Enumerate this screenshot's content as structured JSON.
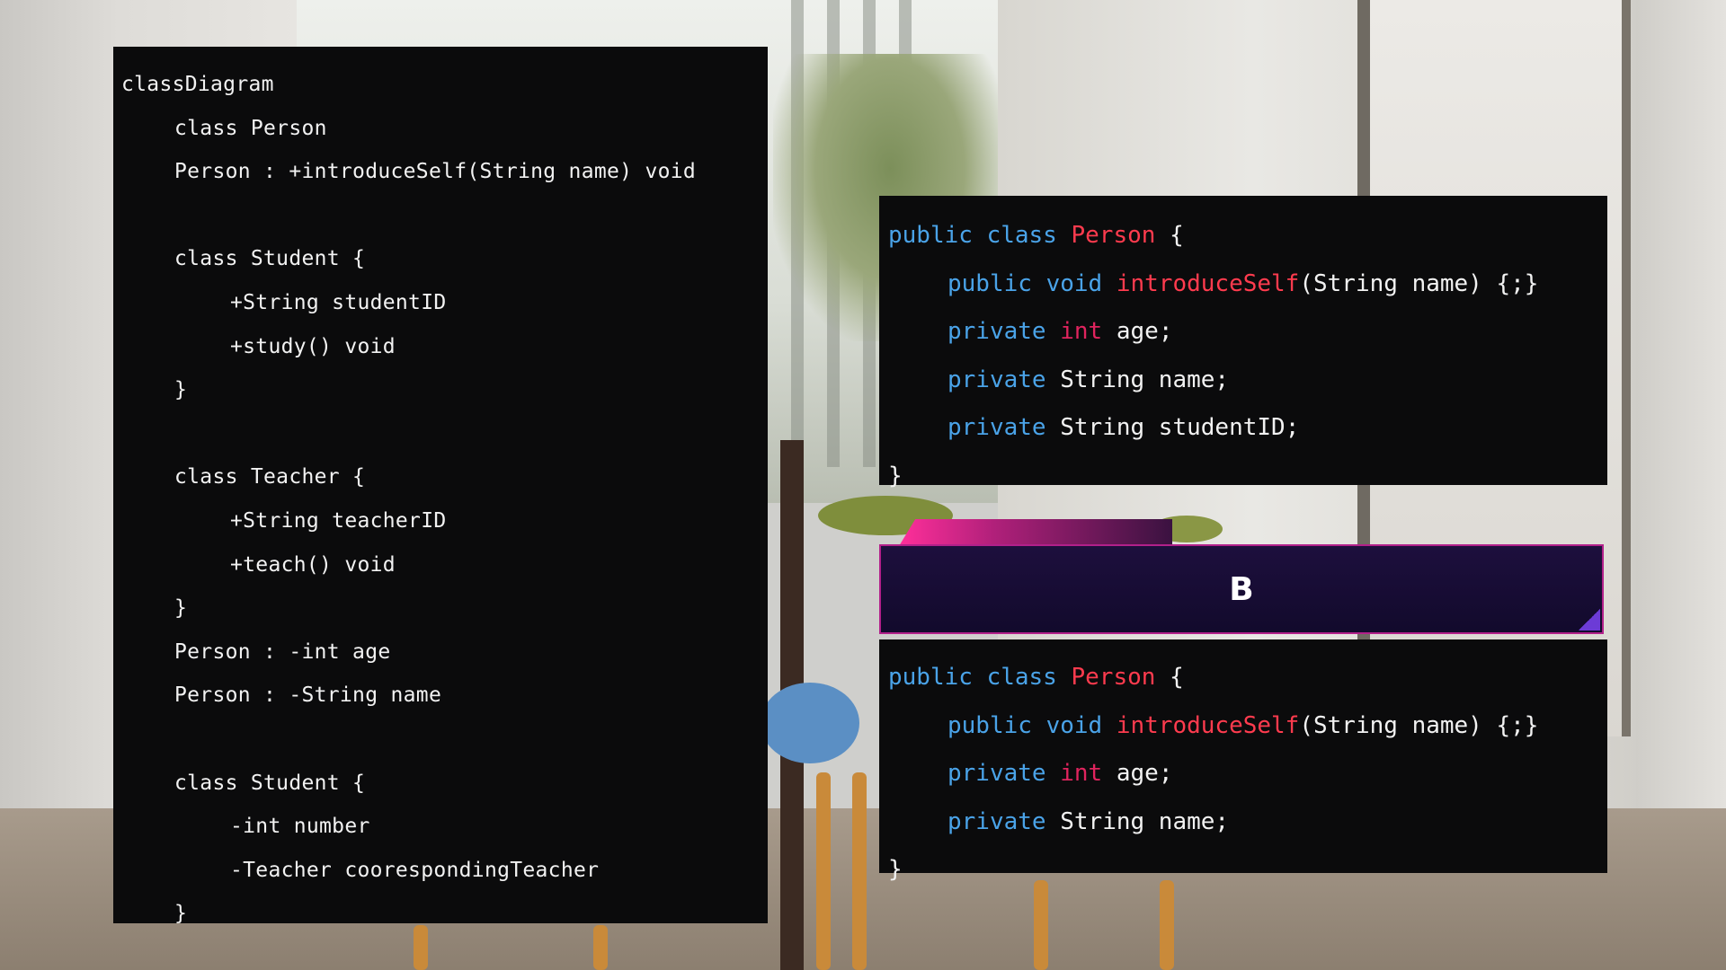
{
  "mermaid_code": {
    "lines": [
      "classDiagram",
      "class Person",
      "Person : +introduceSelf(String name) void",
      "",
      "class Student {",
      "+String studentID",
      "+study() void",
      "}",
      "",
      "class Teacher {",
      "+String teacherID",
      "+teach() void",
      "}",
      "Person : -int age",
      "Person : -String name",
      "",
      "class Student {",
      "-int number",
      "-Teacher coorespondingTeacher",
      "}"
    ]
  },
  "option_a_code": {
    "line1": {
      "kw": "public class ",
      "cls": "Person",
      "rest": " {"
    },
    "line2": {
      "kw": "public void ",
      "method": "introduceSelf",
      "rest": "(String name) {;}"
    },
    "line3": {
      "kw": "private ",
      "ty": "int",
      "rest": " age;"
    },
    "line4": {
      "kw": "private ",
      "rest": "String name;"
    },
    "line5": {
      "kw": "private ",
      "rest": "String studentID;"
    },
    "line6": "}"
  },
  "option_b": {
    "letter": "B",
    "code": {
      "line1": {
        "kw": "public class ",
        "cls": "Person",
        "rest": " {"
      },
      "line2": {
        "kw": "public void ",
        "method": "introduceSelf",
        "rest": "(String name) {;}"
      },
      "line3": {
        "kw": "private ",
        "ty": "int",
        "rest": " age;"
      },
      "line4": {
        "kw": "private ",
        "rest": "String name;"
      },
      "line5": "}"
    }
  },
  "colors": {
    "keyword": "#4aa3e8",
    "class_name": "#ff3b4e",
    "type": "#e0245e",
    "option_border": "#b2208a"
  }
}
